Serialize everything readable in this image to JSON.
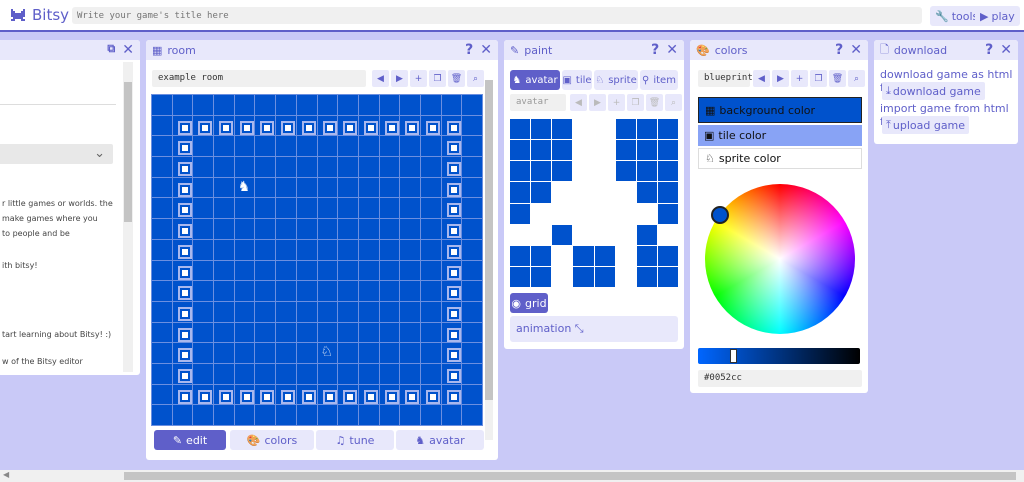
{
  "app": {
    "name": "Bitsy",
    "title_placeholder": "Write your game's title here",
    "tools_label": "tools",
    "play_label": "play"
  },
  "about": {
    "lines": [
      "r little games or worlds. the",
      "make games where you",
      "to people and be",
      "ith bitsy!",
      "tart learning about Bitsy! :)",
      "w of the Bitsy editor"
    ]
  },
  "room": {
    "title": "room",
    "room_name": "example room",
    "tabs": [
      {
        "label": "edit",
        "icon": "pencil-icon"
      },
      {
        "label": "colors",
        "icon": "palette-icon"
      },
      {
        "label": "tune",
        "icon": "music-icon"
      },
      {
        "label": "avatar",
        "icon": "avatar-icon"
      }
    ]
  },
  "paint": {
    "title": "paint",
    "tabs": [
      "avatar",
      "tile",
      "sprite",
      "item"
    ],
    "object_name": "avatar",
    "grid_label": "grid",
    "animation_label": "animation"
  },
  "colors": {
    "title": "colors",
    "palette_name": "blueprint",
    "background_label": "background color",
    "tile_label": "tile color",
    "sprite_label": "sprite color",
    "hex_value": "#0052cc",
    "accent": "#0052cc"
  },
  "download": {
    "title": "download",
    "download_text": "download game as html file:",
    "download_button": "download game",
    "import_text": "import game from html file:",
    "upload_button": "upload game"
  }
}
